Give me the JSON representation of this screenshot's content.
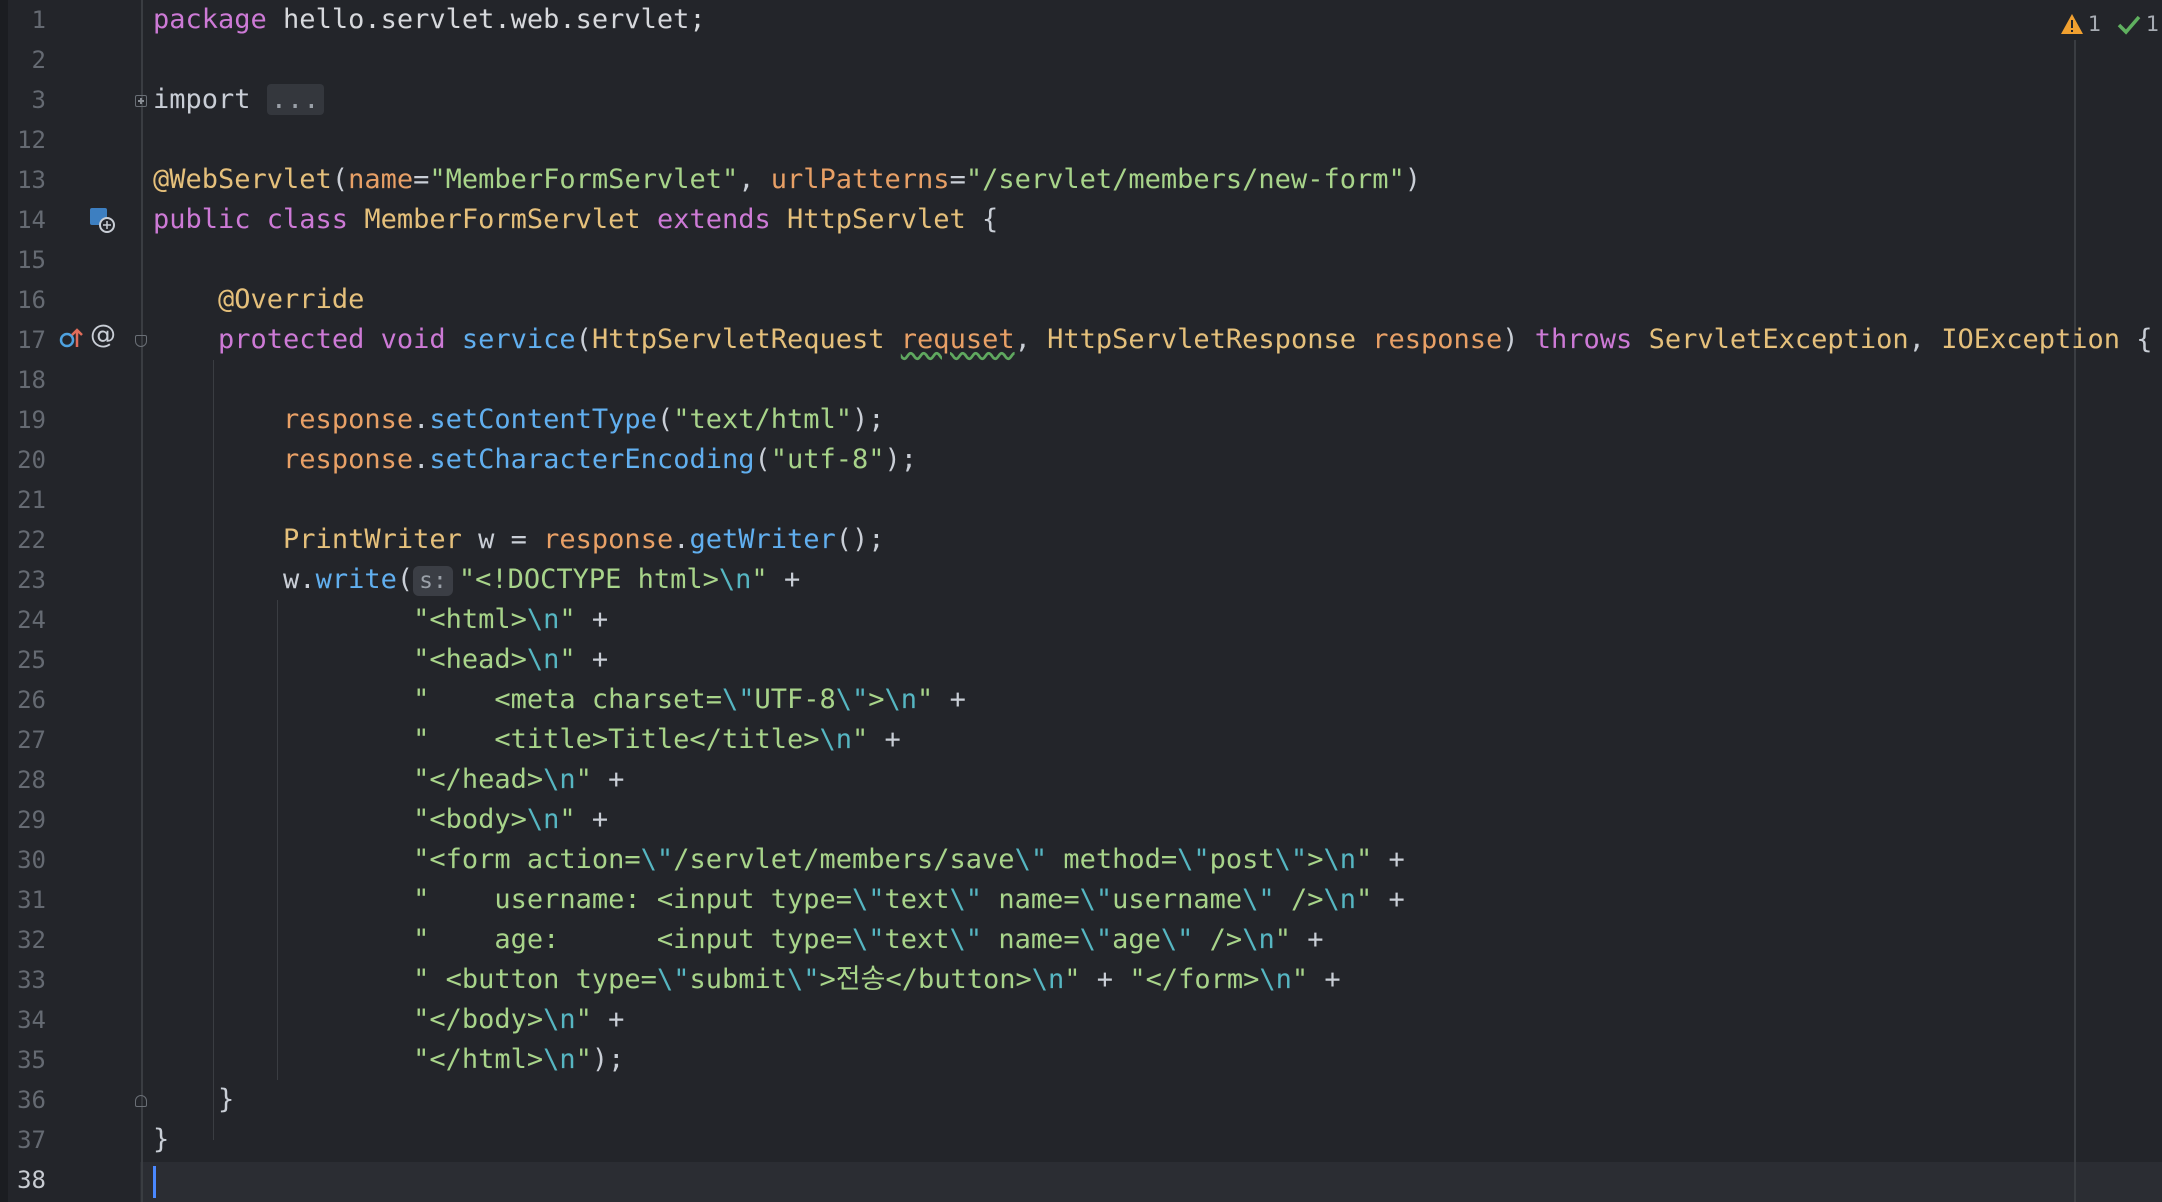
{
  "editor": {
    "language": "java",
    "colors": {
      "background": "#23252a",
      "keyword": "#cd7ad6",
      "string": "#a8d48a",
      "annotation": "#e5c07b",
      "method": "#61afef",
      "parameter": "#e8a066",
      "caret": "#4a88ff"
    },
    "status": {
      "warnings_count": "1",
      "ok_count": "1",
      "warning_icon": "warning-triangle-icon",
      "ok_icon": "check-icon"
    },
    "gutter_icons": {
      "line14": "servlet-class-icon",
      "line17_override": "override-up-arrow-icon",
      "line17_at": "at-annotation-icon"
    },
    "line_numbers": [
      "1",
      "2",
      "3",
      "12",
      "13",
      "14",
      "15",
      "16",
      "17",
      "18",
      "19",
      "20",
      "21",
      "22",
      "23",
      "24",
      "25",
      "26",
      "27",
      "28",
      "29",
      "30",
      "31",
      "32",
      "33",
      "34",
      "35",
      "36",
      "37",
      "38"
    ],
    "lines": [
      {
        "num": "1",
        "tokens": [
          {
            "t": "package",
            "c": "kw"
          },
          {
            "t": " hello.servlet.web.servlet;",
            "c": "pkg"
          }
        ]
      },
      {
        "num": "2",
        "tokens": []
      },
      {
        "num": "3",
        "tokens": [
          {
            "t": "import ",
            "c": "plain"
          },
          {
            "t": "...",
            "c": "fold-ellipsis"
          }
        ]
      },
      {
        "num": "12",
        "tokens": []
      },
      {
        "num": "13",
        "tokens": [
          {
            "t": "@WebServlet",
            "c": "ann"
          },
          {
            "t": "(",
            "c": "plain"
          },
          {
            "t": "name",
            "c": "param"
          },
          {
            "t": "=",
            "c": "plain"
          },
          {
            "t": "\"MemberFormServlet\"",
            "c": "str"
          },
          {
            "t": ", ",
            "c": "plain"
          },
          {
            "t": "urlPatterns",
            "c": "param"
          },
          {
            "t": "=",
            "c": "plain"
          },
          {
            "t": "\"/servlet/members/new-form\"",
            "c": "str"
          },
          {
            "t": ")",
            "c": "plain"
          }
        ]
      },
      {
        "num": "14",
        "tokens": [
          {
            "t": "public class ",
            "c": "kw"
          },
          {
            "t": "MemberFormServlet ",
            "c": "cls"
          },
          {
            "t": "extends ",
            "c": "kw"
          },
          {
            "t": "HttpServlet",
            "c": "cls"
          },
          {
            "t": " {",
            "c": "plain"
          }
        ]
      },
      {
        "num": "15",
        "tokens": []
      },
      {
        "num": "16",
        "tokens": [
          {
            "t": "    ",
            "c": "plain"
          },
          {
            "t": "@Override",
            "c": "ann"
          }
        ]
      },
      {
        "num": "17",
        "tokens": [
          {
            "t": "    ",
            "c": "plain"
          },
          {
            "t": "protected void ",
            "c": "kw"
          },
          {
            "t": "service",
            "c": "method"
          },
          {
            "t": "(",
            "c": "plain"
          },
          {
            "t": "HttpServletRequest ",
            "c": "cls"
          },
          {
            "t": "requset",
            "c": "warnword"
          },
          {
            "t": ", ",
            "c": "plain"
          },
          {
            "t": "HttpServletResponse ",
            "c": "cls"
          },
          {
            "t": "response",
            "c": "param"
          },
          {
            "t": ") ",
            "c": "plain"
          },
          {
            "t": "throws ",
            "c": "kw"
          },
          {
            "t": "ServletException",
            "c": "cls"
          },
          {
            "t": ", ",
            "c": "plain"
          },
          {
            "t": "IOException",
            "c": "cls"
          },
          {
            "t": " {",
            "c": "plain"
          }
        ]
      },
      {
        "num": "18",
        "tokens": []
      },
      {
        "num": "19",
        "tokens": [
          {
            "t": "        ",
            "c": "plain"
          },
          {
            "t": "response",
            "c": "param"
          },
          {
            "t": ".",
            "c": "plain"
          },
          {
            "t": "setContentType",
            "c": "method"
          },
          {
            "t": "(",
            "c": "plain"
          },
          {
            "t": "\"text/html\"",
            "c": "str"
          },
          {
            "t": ");",
            "c": "plain"
          }
        ]
      },
      {
        "num": "20",
        "tokens": [
          {
            "t": "        ",
            "c": "plain"
          },
          {
            "t": "response",
            "c": "param"
          },
          {
            "t": ".",
            "c": "plain"
          },
          {
            "t": "setCharacterEncoding",
            "c": "method"
          },
          {
            "t": "(",
            "c": "plain"
          },
          {
            "t": "\"utf-8\"",
            "c": "str"
          },
          {
            "t": ");",
            "c": "plain"
          }
        ]
      },
      {
        "num": "21",
        "tokens": []
      },
      {
        "num": "22",
        "tokens": [
          {
            "t": "        ",
            "c": "plain"
          },
          {
            "t": "PrintWriter ",
            "c": "cls"
          },
          {
            "t": "w = ",
            "c": "plain"
          },
          {
            "t": "response",
            "c": "param"
          },
          {
            "t": ".",
            "c": "plain"
          },
          {
            "t": "getWriter",
            "c": "method"
          },
          {
            "t": "();",
            "c": "plain"
          }
        ]
      },
      {
        "num": "23",
        "tokens": [
          {
            "t": "        ",
            "c": "plain"
          },
          {
            "t": "w.",
            "c": "plain"
          },
          {
            "t": "write",
            "c": "method"
          },
          {
            "t": "(",
            "c": "plain"
          },
          {
            "t": "s:",
            "c": "hint"
          },
          {
            "t": "\"<!DOCTYPE html>",
            "c": "str"
          },
          {
            "t": "\\n",
            "c": "esc"
          },
          {
            "t": "\"",
            "c": "str"
          },
          {
            "t": " +",
            "c": "plain"
          }
        ]
      },
      {
        "num": "24",
        "tokens": [
          {
            "t": "                ",
            "c": "plain"
          },
          {
            "t": "\"<html>",
            "c": "str"
          },
          {
            "t": "\\n",
            "c": "esc"
          },
          {
            "t": "\"",
            "c": "str"
          },
          {
            "t": " +",
            "c": "plain"
          }
        ]
      },
      {
        "num": "25",
        "tokens": [
          {
            "t": "                ",
            "c": "plain"
          },
          {
            "t": "\"<head>",
            "c": "str"
          },
          {
            "t": "\\n",
            "c": "esc"
          },
          {
            "t": "\"",
            "c": "str"
          },
          {
            "t": " +",
            "c": "plain"
          }
        ]
      },
      {
        "num": "26",
        "tokens": [
          {
            "t": "                ",
            "c": "plain"
          },
          {
            "t": "\"    <meta charset=",
            "c": "str"
          },
          {
            "t": "\\\"",
            "c": "esc"
          },
          {
            "t": "UTF-8",
            "c": "str"
          },
          {
            "t": "\\\"",
            "c": "esc"
          },
          {
            "t": ">",
            "c": "str"
          },
          {
            "t": "\\n",
            "c": "esc"
          },
          {
            "t": "\"",
            "c": "str"
          },
          {
            "t": " +",
            "c": "plain"
          }
        ]
      },
      {
        "num": "27",
        "tokens": [
          {
            "t": "                ",
            "c": "plain"
          },
          {
            "t": "\"    <title>Title</title>",
            "c": "str"
          },
          {
            "t": "\\n",
            "c": "esc"
          },
          {
            "t": "\"",
            "c": "str"
          },
          {
            "t": " +",
            "c": "plain"
          }
        ]
      },
      {
        "num": "28",
        "tokens": [
          {
            "t": "                ",
            "c": "plain"
          },
          {
            "t": "\"</head>",
            "c": "str"
          },
          {
            "t": "\\n",
            "c": "esc"
          },
          {
            "t": "\"",
            "c": "str"
          },
          {
            "t": " +",
            "c": "plain"
          }
        ]
      },
      {
        "num": "29",
        "tokens": [
          {
            "t": "                ",
            "c": "plain"
          },
          {
            "t": "\"<body>",
            "c": "str"
          },
          {
            "t": "\\n",
            "c": "esc"
          },
          {
            "t": "\"",
            "c": "str"
          },
          {
            "t": " +",
            "c": "plain"
          }
        ]
      },
      {
        "num": "30",
        "tokens": [
          {
            "t": "                ",
            "c": "plain"
          },
          {
            "t": "\"<form action=",
            "c": "str"
          },
          {
            "t": "\\\"",
            "c": "esc"
          },
          {
            "t": "/servlet/members/save",
            "c": "str"
          },
          {
            "t": "\\\"",
            "c": "esc"
          },
          {
            "t": " method=",
            "c": "str"
          },
          {
            "t": "\\\"",
            "c": "esc"
          },
          {
            "t": "post",
            "c": "str"
          },
          {
            "t": "\\\"",
            "c": "esc"
          },
          {
            "t": ">",
            "c": "str"
          },
          {
            "t": "\\n",
            "c": "esc"
          },
          {
            "t": "\"",
            "c": "str"
          },
          {
            "t": " +",
            "c": "plain"
          }
        ]
      },
      {
        "num": "31",
        "tokens": [
          {
            "t": "                ",
            "c": "plain"
          },
          {
            "t": "\"    username: <input type=",
            "c": "str"
          },
          {
            "t": "\\\"",
            "c": "esc"
          },
          {
            "t": "text",
            "c": "str"
          },
          {
            "t": "\\\"",
            "c": "esc"
          },
          {
            "t": " name=",
            "c": "str"
          },
          {
            "t": "\\\"",
            "c": "esc"
          },
          {
            "t": "username",
            "c": "str"
          },
          {
            "t": "\\\"",
            "c": "esc"
          },
          {
            "t": " />",
            "c": "str"
          },
          {
            "t": "\\n",
            "c": "esc"
          },
          {
            "t": "\"",
            "c": "str"
          },
          {
            "t": " +",
            "c": "plain"
          }
        ]
      },
      {
        "num": "32",
        "tokens": [
          {
            "t": "                ",
            "c": "plain"
          },
          {
            "t": "\"    age:      <input type=",
            "c": "str"
          },
          {
            "t": "\\\"",
            "c": "esc"
          },
          {
            "t": "text",
            "c": "str"
          },
          {
            "t": "\\\"",
            "c": "esc"
          },
          {
            "t": " name=",
            "c": "str"
          },
          {
            "t": "\\\"",
            "c": "esc"
          },
          {
            "t": "age",
            "c": "str"
          },
          {
            "t": "\\\"",
            "c": "esc"
          },
          {
            "t": " />",
            "c": "str"
          },
          {
            "t": "\\n",
            "c": "esc"
          },
          {
            "t": "\"",
            "c": "str"
          },
          {
            "t": " +",
            "c": "plain"
          }
        ]
      },
      {
        "num": "33",
        "tokens": [
          {
            "t": "                ",
            "c": "plain"
          },
          {
            "t": "\" <button type=",
            "c": "str"
          },
          {
            "t": "\\\"",
            "c": "esc"
          },
          {
            "t": "submit",
            "c": "str"
          },
          {
            "t": "\\\"",
            "c": "esc"
          },
          {
            "t": ">전송</button>",
            "c": "str"
          },
          {
            "t": "\\n",
            "c": "esc"
          },
          {
            "t": "\"",
            "c": "str"
          },
          {
            "t": " + ",
            "c": "plain"
          },
          {
            "t": "\"</form>",
            "c": "str"
          },
          {
            "t": "\\n",
            "c": "esc"
          },
          {
            "t": "\"",
            "c": "str"
          },
          {
            "t": " +",
            "c": "plain"
          }
        ]
      },
      {
        "num": "34",
        "tokens": [
          {
            "t": "                ",
            "c": "plain"
          },
          {
            "t": "\"</body>",
            "c": "str"
          },
          {
            "t": "\\n",
            "c": "esc"
          },
          {
            "t": "\"",
            "c": "str"
          },
          {
            "t": " +",
            "c": "plain"
          }
        ]
      },
      {
        "num": "35",
        "tokens": [
          {
            "t": "                ",
            "c": "plain"
          },
          {
            "t": "\"</html>",
            "c": "str"
          },
          {
            "t": "\\n",
            "c": "esc"
          },
          {
            "t": "\"",
            "c": "str"
          },
          {
            "t": ");",
            "c": "plain"
          }
        ]
      },
      {
        "num": "36",
        "tokens": [
          {
            "t": "    }",
            "c": "plain"
          }
        ]
      },
      {
        "num": "37",
        "tokens": [
          {
            "t": "}",
            "c": "plain"
          }
        ]
      },
      {
        "num": "38",
        "tokens": []
      }
    ]
  }
}
